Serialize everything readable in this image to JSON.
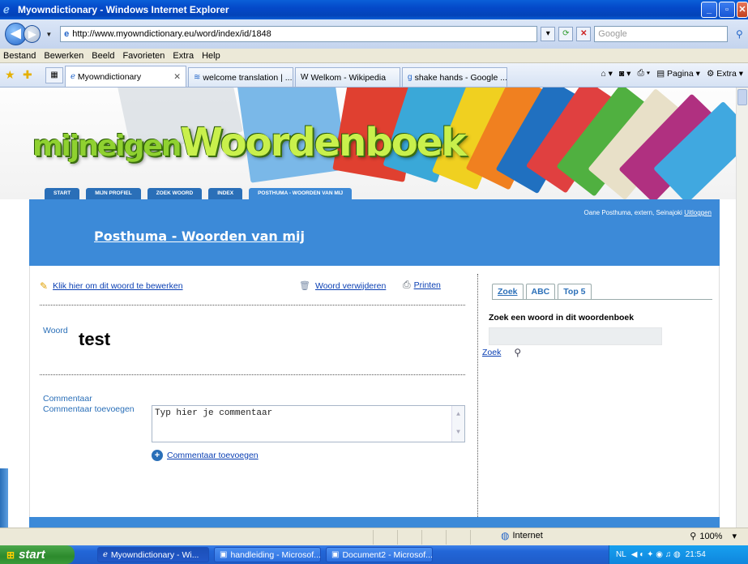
{
  "window": {
    "title": "Myowndictionary - Windows Internet Explorer"
  },
  "address": {
    "url": "http://www.myowndictionary.eu/word/index/id/1848",
    "search_placeholder": "Google"
  },
  "menu": [
    "Bestand",
    "Bewerken",
    "Beeld",
    "Favorieten",
    "Extra",
    "Help"
  ],
  "tabs": [
    {
      "label": "Myowndictionary",
      "active": true
    },
    {
      "label": "welcome translation | ...",
      "active": false
    },
    {
      "label": "Welkom - Wikipedia",
      "active": false
    },
    {
      "label": "shake hands - Google ...",
      "active": false
    }
  ],
  "toolbar": {
    "page_label": "Pagina",
    "extra_label": "Extra"
  },
  "site": {
    "logo": {
      "part1": "mijn",
      "part2": "eigen",
      "part3": "Woordenboek"
    },
    "nav": [
      "START",
      "MIJN PROFIEL",
      "ZOEK WOORD",
      "INDEX",
      "POSTHUMA - WOORDEN VAN MIJ"
    ],
    "user_text": "Oane Posthuma, extern, Seinajoki",
    "logout": "Uitloggen",
    "page_title": "Posthuma - Woorden van mij"
  },
  "word": {
    "edit_link": "Klik hier om dit woord te bewerken",
    "delete_link": "Woord verwijderen",
    "print_link": "Printen",
    "label": "Woord",
    "value": "test",
    "comment_label": "Commentaar",
    "add_comment_label": "Commentaar toevoegen",
    "comment_placeholder": "Typ hier je commentaar",
    "add_comment_link": "Commentaar toevoegen"
  },
  "search_panel": {
    "tabs": [
      "Zoek",
      "ABC",
      "Top 5"
    ],
    "title": "Zoek een woord in dit woordenboek",
    "button": "Zoek"
  },
  "status": {
    "zone": "Internet",
    "zoom": "100%"
  },
  "taskbar": {
    "start": "start",
    "items": [
      "Myowndictionary - Wi...",
      "handleiding - Microsof...",
      "Document2 - Microsof..."
    ],
    "lang": "NL",
    "clock": "21:54"
  }
}
